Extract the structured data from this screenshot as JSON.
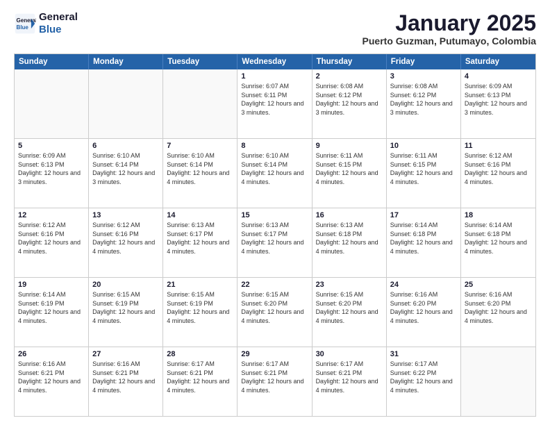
{
  "header": {
    "logo_line1": "General",
    "logo_line2": "Blue",
    "month_title": "January 2025",
    "subtitle": "Puerto Guzman, Putumayo, Colombia"
  },
  "days_of_week": [
    "Sunday",
    "Monday",
    "Tuesday",
    "Wednesday",
    "Thursday",
    "Friday",
    "Saturday"
  ],
  "weeks": [
    [
      {
        "day": "",
        "empty": true
      },
      {
        "day": "",
        "empty": true
      },
      {
        "day": "",
        "empty": true
      },
      {
        "day": "1",
        "info": "Sunrise: 6:07 AM\nSunset: 6:11 PM\nDaylight: 12 hours and 3 minutes."
      },
      {
        "day": "2",
        "info": "Sunrise: 6:08 AM\nSunset: 6:12 PM\nDaylight: 12 hours and 3 minutes."
      },
      {
        "day": "3",
        "info": "Sunrise: 6:08 AM\nSunset: 6:12 PM\nDaylight: 12 hours and 3 minutes."
      },
      {
        "day": "4",
        "info": "Sunrise: 6:09 AM\nSunset: 6:13 PM\nDaylight: 12 hours and 3 minutes."
      }
    ],
    [
      {
        "day": "5",
        "info": "Sunrise: 6:09 AM\nSunset: 6:13 PM\nDaylight: 12 hours and 3 minutes."
      },
      {
        "day": "6",
        "info": "Sunrise: 6:10 AM\nSunset: 6:14 PM\nDaylight: 12 hours and 3 minutes."
      },
      {
        "day": "7",
        "info": "Sunrise: 6:10 AM\nSunset: 6:14 PM\nDaylight: 12 hours and 4 minutes."
      },
      {
        "day": "8",
        "info": "Sunrise: 6:10 AM\nSunset: 6:14 PM\nDaylight: 12 hours and 4 minutes."
      },
      {
        "day": "9",
        "info": "Sunrise: 6:11 AM\nSunset: 6:15 PM\nDaylight: 12 hours and 4 minutes."
      },
      {
        "day": "10",
        "info": "Sunrise: 6:11 AM\nSunset: 6:15 PM\nDaylight: 12 hours and 4 minutes."
      },
      {
        "day": "11",
        "info": "Sunrise: 6:12 AM\nSunset: 6:16 PM\nDaylight: 12 hours and 4 minutes."
      }
    ],
    [
      {
        "day": "12",
        "info": "Sunrise: 6:12 AM\nSunset: 6:16 PM\nDaylight: 12 hours and 4 minutes."
      },
      {
        "day": "13",
        "info": "Sunrise: 6:12 AM\nSunset: 6:16 PM\nDaylight: 12 hours and 4 minutes."
      },
      {
        "day": "14",
        "info": "Sunrise: 6:13 AM\nSunset: 6:17 PM\nDaylight: 12 hours and 4 minutes."
      },
      {
        "day": "15",
        "info": "Sunrise: 6:13 AM\nSunset: 6:17 PM\nDaylight: 12 hours and 4 minutes."
      },
      {
        "day": "16",
        "info": "Sunrise: 6:13 AM\nSunset: 6:18 PM\nDaylight: 12 hours and 4 minutes."
      },
      {
        "day": "17",
        "info": "Sunrise: 6:14 AM\nSunset: 6:18 PM\nDaylight: 12 hours and 4 minutes."
      },
      {
        "day": "18",
        "info": "Sunrise: 6:14 AM\nSunset: 6:18 PM\nDaylight: 12 hours and 4 minutes."
      }
    ],
    [
      {
        "day": "19",
        "info": "Sunrise: 6:14 AM\nSunset: 6:19 PM\nDaylight: 12 hours and 4 minutes."
      },
      {
        "day": "20",
        "info": "Sunrise: 6:15 AM\nSunset: 6:19 PM\nDaylight: 12 hours and 4 minutes."
      },
      {
        "day": "21",
        "info": "Sunrise: 6:15 AM\nSunset: 6:19 PM\nDaylight: 12 hours and 4 minutes."
      },
      {
        "day": "22",
        "info": "Sunrise: 6:15 AM\nSunset: 6:20 PM\nDaylight: 12 hours and 4 minutes."
      },
      {
        "day": "23",
        "info": "Sunrise: 6:15 AM\nSunset: 6:20 PM\nDaylight: 12 hours and 4 minutes."
      },
      {
        "day": "24",
        "info": "Sunrise: 6:16 AM\nSunset: 6:20 PM\nDaylight: 12 hours and 4 minutes."
      },
      {
        "day": "25",
        "info": "Sunrise: 6:16 AM\nSunset: 6:20 PM\nDaylight: 12 hours and 4 minutes."
      }
    ],
    [
      {
        "day": "26",
        "info": "Sunrise: 6:16 AM\nSunset: 6:21 PM\nDaylight: 12 hours and 4 minutes."
      },
      {
        "day": "27",
        "info": "Sunrise: 6:16 AM\nSunset: 6:21 PM\nDaylight: 12 hours and 4 minutes."
      },
      {
        "day": "28",
        "info": "Sunrise: 6:17 AM\nSunset: 6:21 PM\nDaylight: 12 hours and 4 minutes."
      },
      {
        "day": "29",
        "info": "Sunrise: 6:17 AM\nSunset: 6:21 PM\nDaylight: 12 hours and 4 minutes."
      },
      {
        "day": "30",
        "info": "Sunrise: 6:17 AM\nSunset: 6:21 PM\nDaylight: 12 hours and 4 minutes."
      },
      {
        "day": "31",
        "info": "Sunrise: 6:17 AM\nSunset: 6:22 PM\nDaylight: 12 hours and 4 minutes."
      },
      {
        "day": "",
        "empty": true
      }
    ]
  ]
}
